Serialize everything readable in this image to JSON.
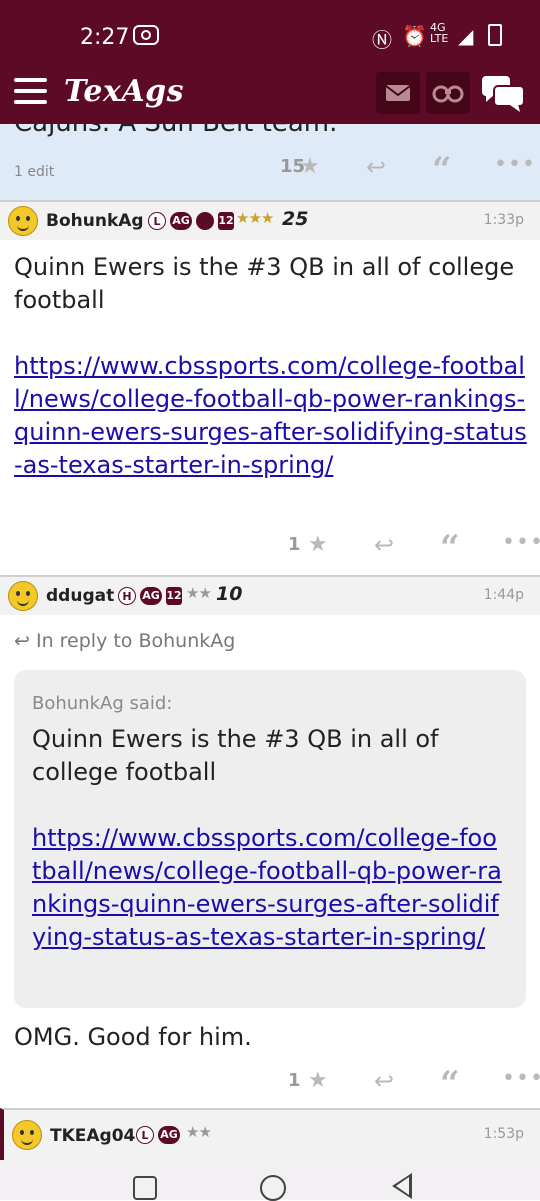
{
  "status_bar": {
    "time": "2:27",
    "network": "4G LTE"
  },
  "app": {
    "logo": "TexAgs",
    "colors": {
      "brand": "#5c0a25",
      "link": "#1a0dab"
    }
  },
  "post0": {
    "text_fragment": "Cajuns. A Sun Belt team.",
    "edit_note": "1 edit",
    "stars": "15"
  },
  "post1": {
    "user": "BohunkAg",
    "badges": [
      "L",
      "AG",
      "12"
    ],
    "rank_stars": "★★★",
    "tally": "25",
    "time": "1:33p",
    "text": "Quinn Ewers is the #3 QB in all of college football",
    "link": "https://www.cbssports.com/college-football/news/college-football-qb-power-rankings-quinn-ewers-surges-after-solidifying-status-as-texas-starter-in-spring/",
    "stars": "1"
  },
  "post2": {
    "user": "ddugat",
    "badges": [
      "H",
      "AG",
      "12"
    ],
    "rank_stars": "★★",
    "tally": "10",
    "time": "1:44p",
    "in_reply": "In reply to BohunkAg",
    "quote_said": "BohunkAg said:",
    "quote_text": "Quinn Ewers is the #3 QB in all of college football",
    "quote_link": "https://www.cbssports.com/college-football/news/college-football-qb-power-rankings-quinn-ewers-surges-after-solidifying-status-as-texas-starter-in-spring/",
    "text": "OMG. Good for him.",
    "stars": "1"
  },
  "post3": {
    "user": "TKEAg04",
    "badges": [
      "L",
      "AG"
    ],
    "rank_stars": "★★",
    "time": "1:53p"
  },
  "icons": [
    "menu-icon",
    "mail-icon",
    "binoculars-icon",
    "chat-icon",
    "star-icon",
    "reply-icon",
    "quote-icon",
    "more-icon"
  ]
}
